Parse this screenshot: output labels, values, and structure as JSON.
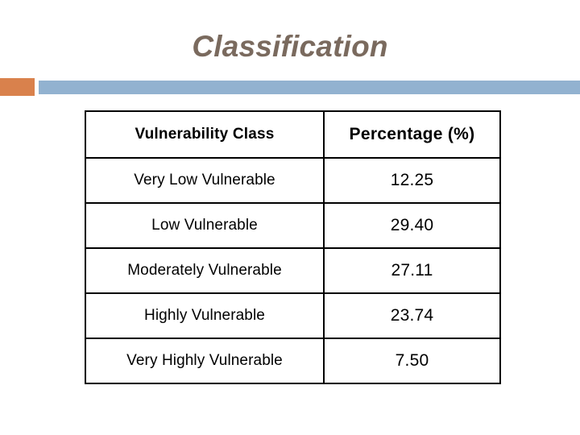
{
  "slide": {
    "title": "Classification"
  },
  "banner": {
    "accent_color": "#d9814c",
    "bar_color": "#92b2d0"
  },
  "theme": {
    "title_color": "#7a6a5e",
    "table_border_color": "#000000",
    "text_color": "#000000"
  },
  "table": {
    "columns": [
      {
        "label": "Vulnerability Class"
      },
      {
        "label": "Percentage (%)"
      }
    ],
    "rows": [
      {
        "vulnerability_class": "Very Low Vulnerable",
        "percentage": "12.25"
      },
      {
        "vulnerability_class": "Low Vulnerable",
        "percentage": "29.40"
      },
      {
        "vulnerability_class": "Moderately Vulnerable",
        "percentage": "27.11"
      },
      {
        "vulnerability_class": "Highly Vulnerable",
        "percentage": "23.74"
      },
      {
        "vulnerability_class": "Very Highly Vulnerable",
        "percentage": "7.50"
      }
    ]
  },
  "chart_data": {
    "type": "table",
    "title": "Classification",
    "categories": [
      "Very Low Vulnerable",
      "Low Vulnerable",
      "Moderately Vulnerable",
      "Highly Vulnerable",
      "Very Highly Vulnerable"
    ],
    "values": [
      12.25,
      29.4,
      27.11,
      23.74,
      7.5
    ],
    "xlabel": "Vulnerability Class",
    "ylabel": "Percentage (%)",
    "column_headers": [
      "Vulnerability Class",
      "Percentage (%)"
    ],
    "units": "percent",
    "total": 100.0
  }
}
